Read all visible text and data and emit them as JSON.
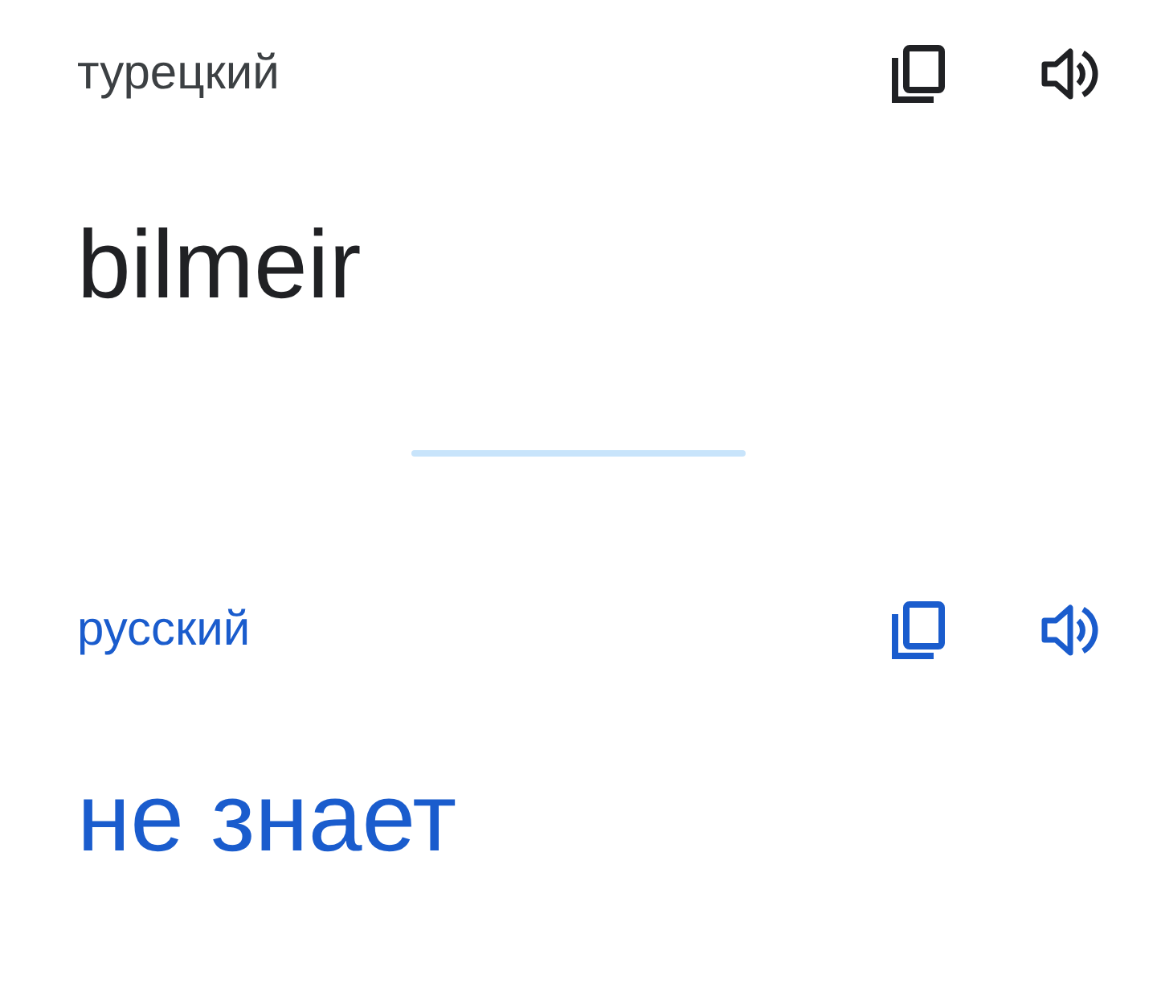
{
  "panels": [
    {
      "kind": "source",
      "language": "турецкий",
      "text": "bilmeir"
    },
    {
      "kind": "target",
      "language": "русский",
      "text": "не знает"
    }
  ]
}
